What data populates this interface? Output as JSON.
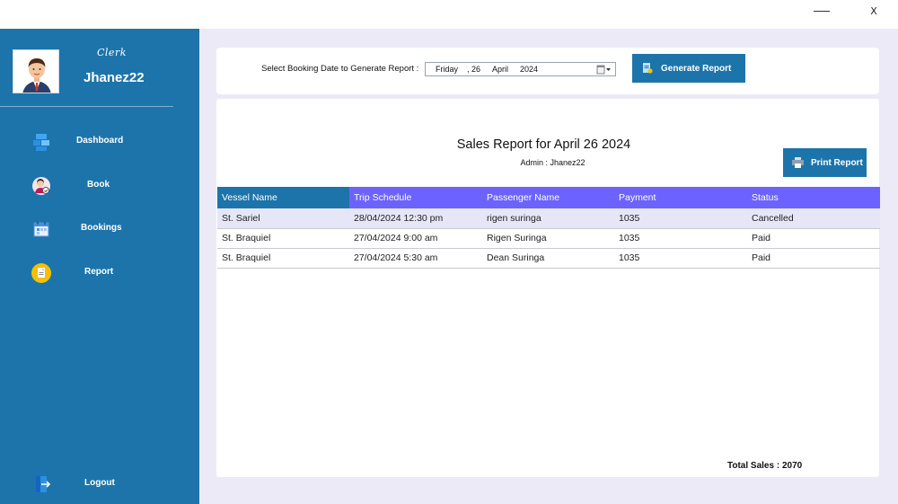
{
  "window": {
    "minimize_label": "——",
    "close_label": "X"
  },
  "sidebar": {
    "role": "Clerk",
    "username": "Jhanez22",
    "items": [
      {
        "label": "Dashboard",
        "icon": "dashboard-icon"
      },
      {
        "label": "Book",
        "icon": "person-book-icon"
      },
      {
        "label": "Bookings",
        "icon": "calendar-icon"
      },
      {
        "label": "Report",
        "icon": "report-icon"
      }
    ],
    "logout": {
      "label": "Logout",
      "icon": "logout-icon"
    }
  },
  "toolbar": {
    "date_label": "Select Booking Date to Generate Report :",
    "date": {
      "weekday": "Friday",
      "sep": ",",
      "day": "26",
      "month": "April",
      "year": "2024"
    },
    "generate_label": "Generate Report"
  },
  "report": {
    "title": "Sales Report for April 26 2024",
    "admin": "Admin : Jhanez22",
    "print_label": "Print Report",
    "columns": [
      "Vessel Name",
      "Trip Schedule",
      "Passenger Name",
      "Payment",
      "Status"
    ],
    "rows": [
      [
        "St. Sariel",
        "28/04/2024 12:30 pm",
        "rigen suringa",
        "1035",
        "Cancelled"
      ],
      [
        "St. Braquiel",
        "27/04/2024 9:00 am",
        "Rigen Suringa",
        "1035",
        "Paid"
      ],
      [
        "St. Braquiel",
        "27/04/2024 5:30 am",
        "Dean Suringa",
        "1035",
        "Paid"
      ]
    ],
    "total": "Total Sales : 2070"
  },
  "colors": {
    "sidebar": "#1d74aa",
    "header_accent": "#6c63ff",
    "background": "#eceaf6"
  }
}
